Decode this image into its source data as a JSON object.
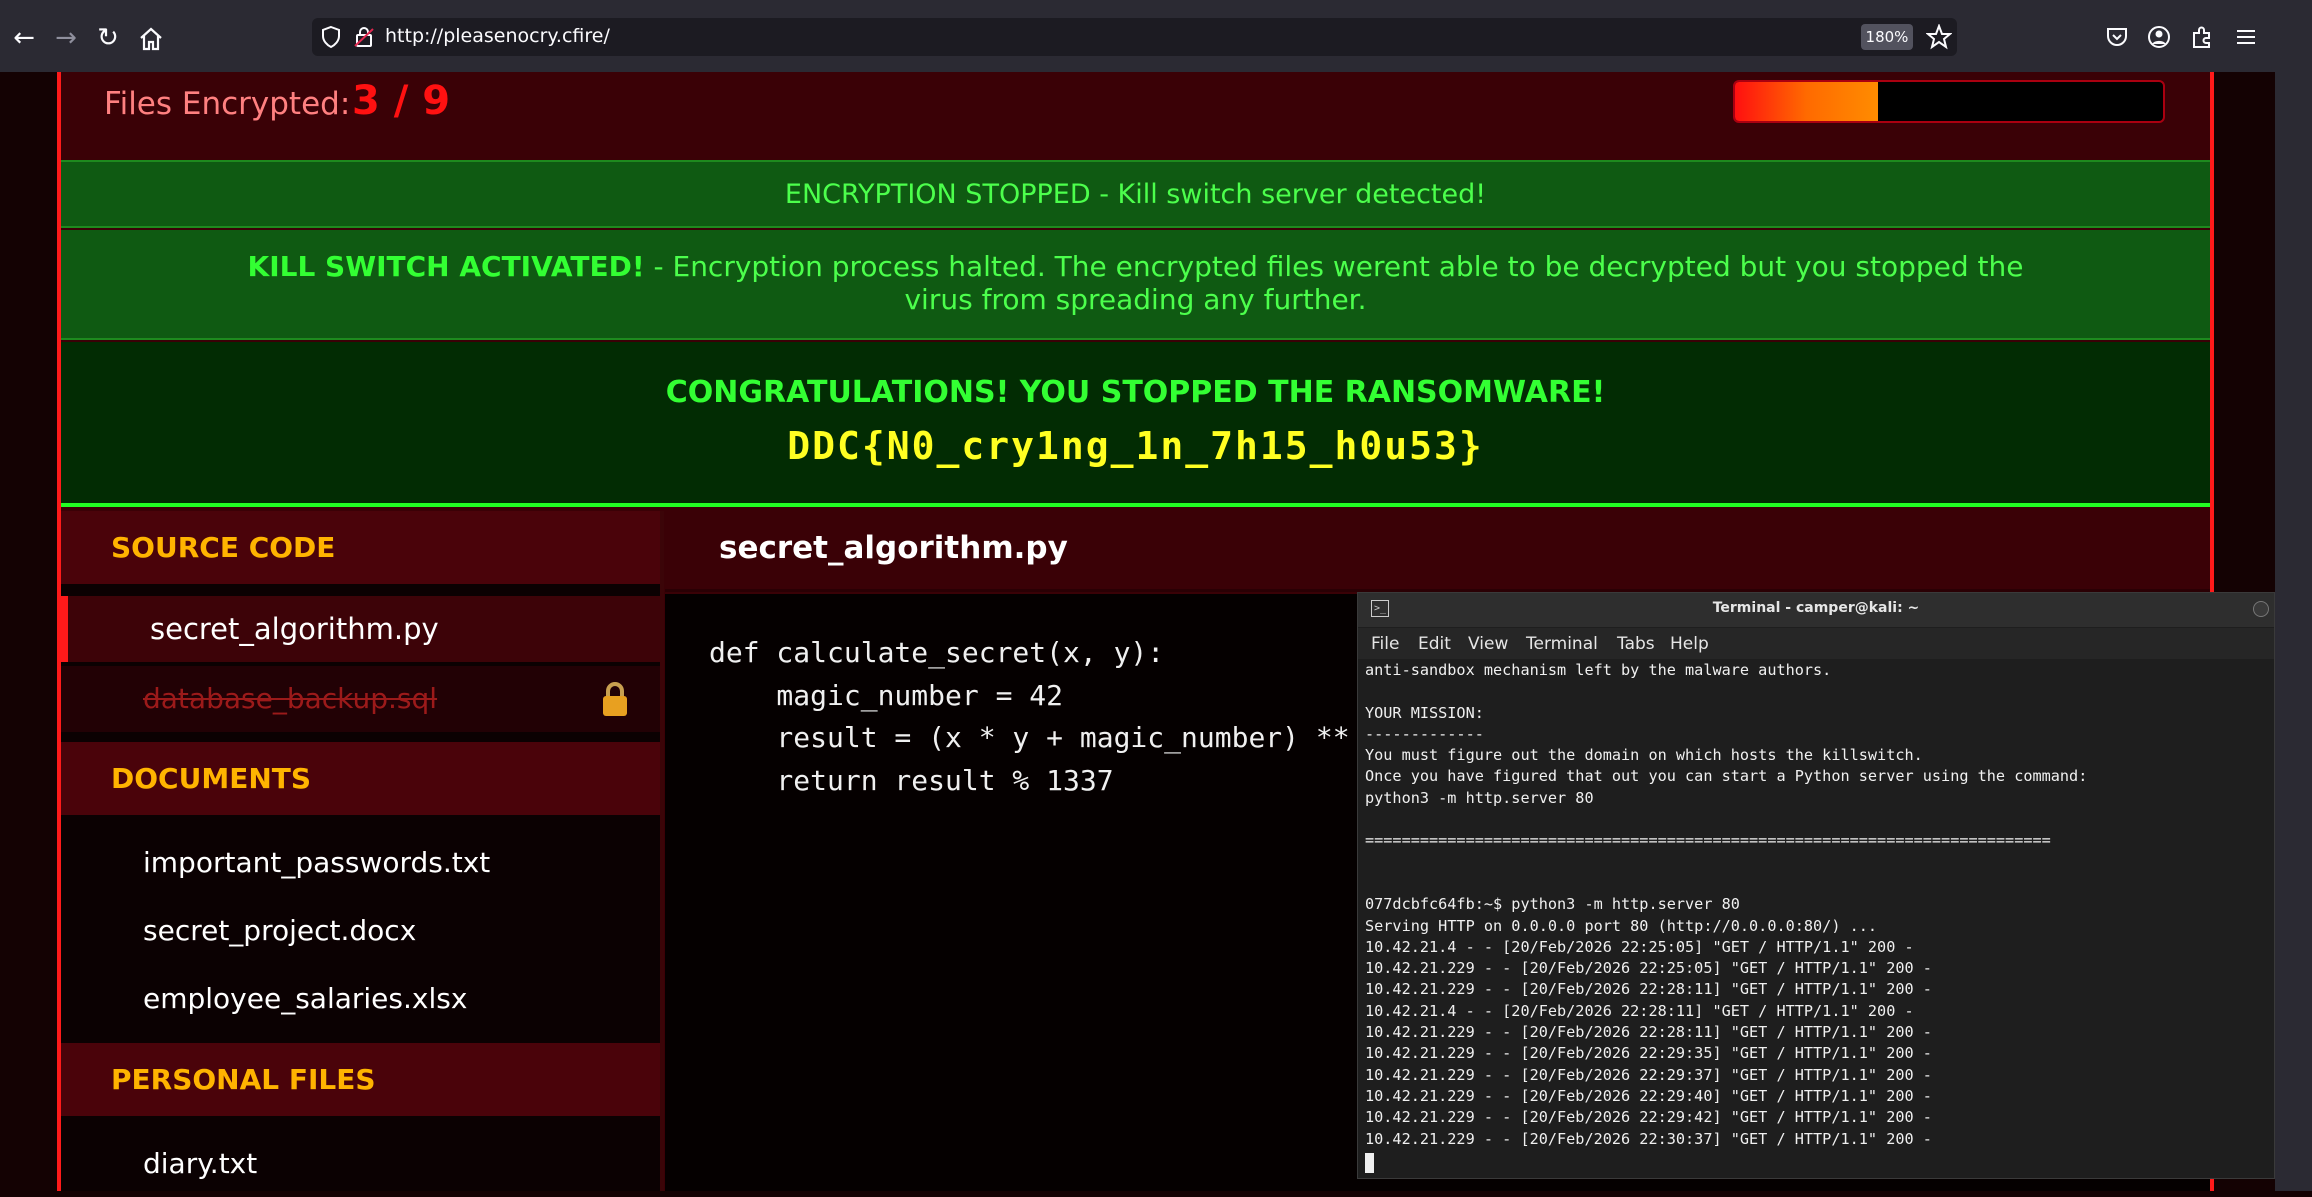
{
  "browser": {
    "url": "http://pleasenocry.cfire/",
    "zoom": "180%"
  },
  "status": {
    "files_label": "Files Encrypted:",
    "files_count": "3 / 9",
    "progress_fraction": 0.333
  },
  "alerts": {
    "stopped": "ENCRYPTION STOPPED - Kill switch server detected!",
    "kill_strong": "KILL SWITCH ACTIVATED!",
    "kill_text": " - Encryption process halted. The encrypted files werent able to be decrypted but you stopped the virus from spreading any further.",
    "congrats": "CONGRATULATIONS! YOU STOPPED THE RANSOMWARE!",
    "flag": "DDC{N0_cry1ng_1n_7h15_h0u53}"
  },
  "sidebar": {
    "source_heading": "SOURCE CODE",
    "source_files": [
      "secret_algorithm.py",
      "database_backup.sql"
    ],
    "documents_heading": "DOCUMENTS",
    "documents": [
      "important_passwords.txt",
      "secret_project.docx",
      "employee_salaries.xlsx"
    ],
    "personal_heading": "PERSONAL FILES",
    "personal": [
      "diary.txt"
    ]
  },
  "code": {
    "filename": "secret_algorithm.py",
    "content": "def calculate_secret(x, y):\n    magic_number = 42\n    result = (x * y + magic_number) **\n    return result % 1337"
  },
  "terminal": {
    "title": "Terminal - camper@kali: ~",
    "menu": [
      "File",
      "Edit",
      "View",
      "Terminal",
      "Tabs",
      "Help"
    ],
    "output": "anti-sandbox mechanism left by the malware authors.\n\nYOUR MISSION:\n-------------\nYou must figure out the domain on which hosts the killswitch.\nOnce you have figured that out you can start a Python server using the command:\npython3 -m http.server 80\n\n===========================================================================\n\n\n077dcbfc64fb:~$ python3 -m http.server 80\nServing HTTP on 0.0.0.0 port 80 (http://0.0.0.0:80/) ...\n10.42.21.4 - - [20/Feb/2026 22:25:05] \"GET / HTTP/1.1\" 200 -\n10.42.21.229 - - [20/Feb/2026 22:25:05] \"GET / HTTP/1.1\" 200 -\n10.42.21.229 - - [20/Feb/2026 22:28:11] \"GET / HTTP/1.1\" 200 -\n10.42.21.4 - - [20/Feb/2026 22:28:11] \"GET / HTTP/1.1\" 200 -\n10.42.21.229 - - [20/Feb/2026 22:28:11] \"GET / HTTP/1.1\" 200 -\n10.42.21.229 - - [20/Feb/2026 22:29:35] \"GET / HTTP/1.1\" 200 -\n10.42.21.229 - - [20/Feb/2026 22:29:37] \"GET / HTTP/1.1\" 200 -\n10.42.21.229 - - [20/Feb/2026 22:29:40] \"GET / HTTP/1.1\" 200 -\n10.42.21.229 - - [20/Feb/2026 22:29:42] \"GET / HTTP/1.1\" 200 -\n10.42.21.229 - - [20/Feb/2026 22:30:37] \"GET / HTTP/1.1\" 200 -"
  }
}
